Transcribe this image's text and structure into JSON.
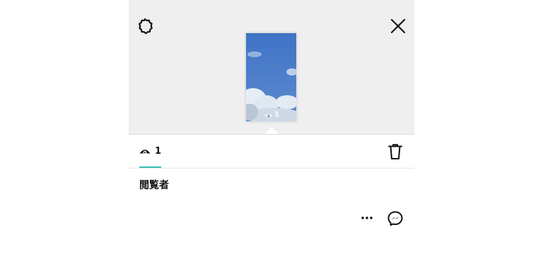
{
  "story": {
    "thumbnail_view_count": "1"
  },
  "stats": {
    "view_count": "1"
  },
  "viewers": {
    "title": "閲覧者"
  },
  "icons": {
    "settings": "gear-icon",
    "close": "close-icon",
    "eye": "eye-icon",
    "trash": "trash-icon",
    "more": "more-options-icon",
    "messenger": "messenger-icon"
  },
  "colors": {
    "top_background": "#efefef",
    "tab_underline": "#38c0b4",
    "sky_blue": "#4a78c4"
  }
}
